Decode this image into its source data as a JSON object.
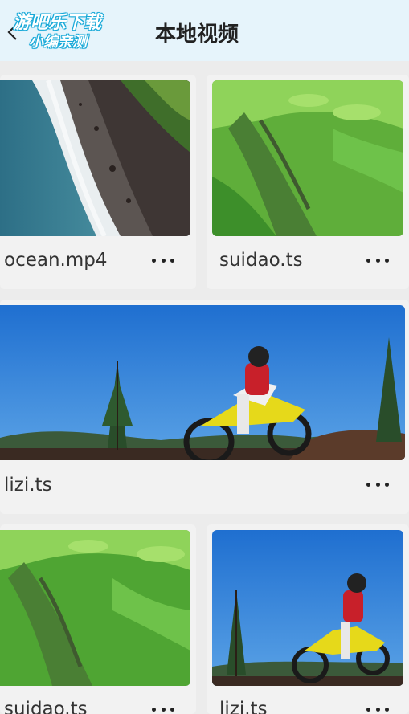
{
  "header": {
    "title": "本地视频",
    "watermark_line1": "游吧乐下载",
    "watermark_line2": "小编亲测"
  },
  "videos": [
    {
      "name": "ocean.mp4",
      "thumbnail": "aerial-coastline"
    },
    {
      "name": "suidao.ts",
      "thumbnail": "green-hillside"
    },
    {
      "name": "lizi.ts",
      "thumbnail": "motocross-rider"
    },
    {
      "name": "suidao.ts",
      "thumbnail": "green-hillside"
    },
    {
      "name": "lizi.ts",
      "thumbnail": "motocross-rider"
    }
  ],
  "colors": {
    "header_bg": "#e6f4fb",
    "page_bg": "#ececec",
    "card_bg": "#f2f2f2",
    "text": "#333333"
  }
}
